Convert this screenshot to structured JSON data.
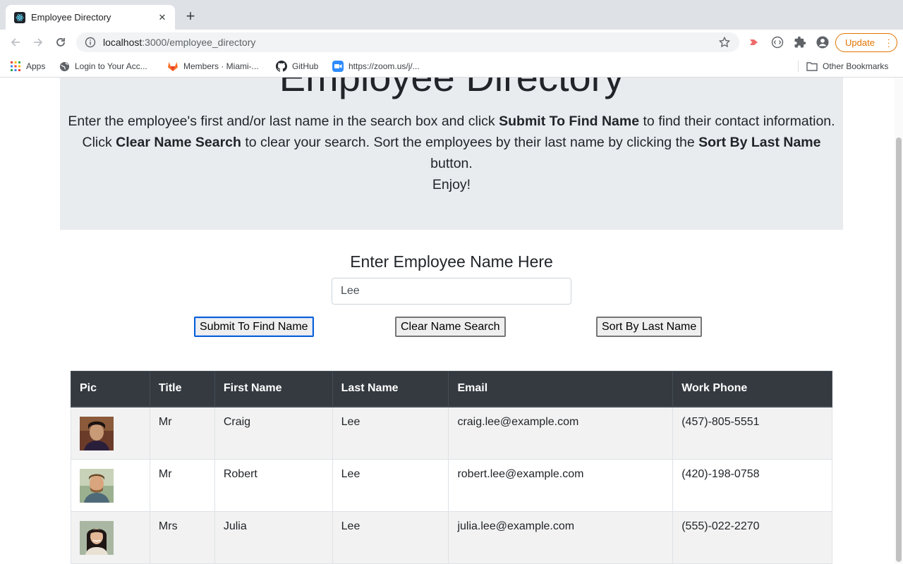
{
  "browser": {
    "tab_title": "Employee Directory",
    "url_host": "localhost",
    "url_path": ":3000/employee_directory",
    "update_label": "Update",
    "bookmarks": [
      {
        "label": "Apps",
        "icon": "apps-grid-icon"
      },
      {
        "label": "Login to Your Acc...",
        "icon": "globe-icon"
      },
      {
        "label": "Members · Miami-...",
        "icon": "gitlab-icon"
      },
      {
        "label": "GitHub",
        "icon": "github-icon"
      },
      {
        "label": "https://zoom.us/j/...",
        "icon": "zoom-icon"
      }
    ],
    "other_bookmarks": "Other Bookmarks"
  },
  "jumbotron": {
    "title": "Employee Directory",
    "line1_pre": "Enter the employee's first and/or last name in the search box and click ",
    "line1_bold": "Submit To Find Name",
    "line1_post": " to find their contact information.",
    "line2_pre": "Click ",
    "line2_bold1": "Clear Name Search",
    "line2_mid": " to clear your search. Sort the employees by their last name by clicking the ",
    "line2_bold2": "Sort By Last Name",
    "line2_post": " button.",
    "line3": "Enjoy!"
  },
  "search": {
    "heading": "Enter Employee Name Here",
    "value": "Lee",
    "submit_label": "Submit To Find Name",
    "clear_label": "Clear Name Search",
    "sort_label": "Sort By Last Name"
  },
  "table": {
    "headers": [
      "Pic",
      "Title",
      "First Name",
      "Last Name",
      "Email",
      "Work Phone"
    ],
    "rows": [
      {
        "title": "Mr",
        "first": "Craig",
        "last": "Lee",
        "email": "craig.lee@example.com",
        "phone": "(457)-805-5551"
      },
      {
        "title": "Mr",
        "first": "Robert",
        "last": "Lee",
        "email": "robert.lee@example.com",
        "phone": "(420)-198-0758"
      },
      {
        "title": "Mrs",
        "first": "Julia",
        "last": "Lee",
        "email": "julia.lee@example.com",
        "phone": "(555)-022-2270"
      }
    ]
  },
  "colors": {
    "table_header_bg": "#343a40",
    "jumbotron_bg": "#e9ecef",
    "update_accent": "#e37400"
  }
}
